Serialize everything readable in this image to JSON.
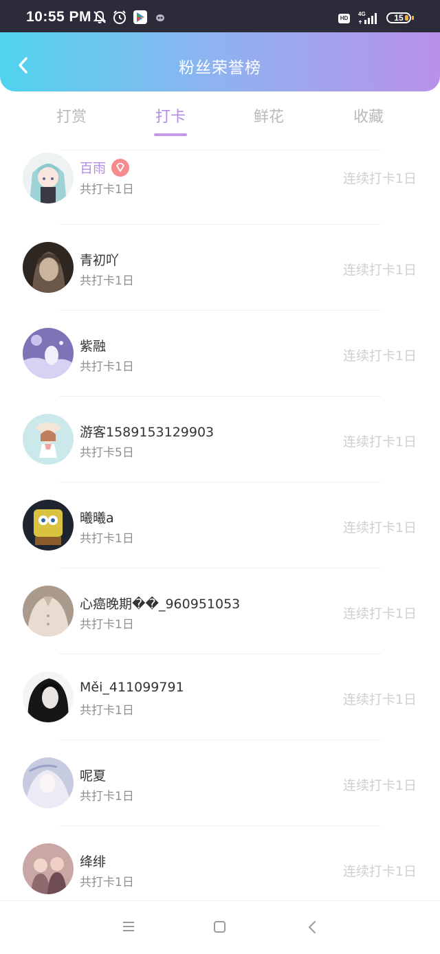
{
  "status_bar": {
    "time": "10:55 PM",
    "network": "4G",
    "hd_label": "HD",
    "battery": "15",
    "icons": [
      "bell-off-icon",
      "alarm-icon",
      "play-store-icon",
      "notification-dot-icon",
      "hd-icon",
      "signal-icon",
      "battery-icon"
    ]
  },
  "header": {
    "title": "粉丝荣誉榜",
    "back_icon": "chevron-left-icon",
    "gradient": [
      "#4fd3ee",
      "#b991ea"
    ]
  },
  "tabs": [
    {
      "label": "打赏",
      "active": false
    },
    {
      "label": "打卡",
      "active": true
    },
    {
      "label": "鲜花",
      "active": false
    },
    {
      "label": "收藏",
      "active": false
    }
  ],
  "accent_color": "#b38de4",
  "fans": [
    {
      "name": "百雨",
      "total": "共打卡1日",
      "streak": "连续打卡1日",
      "vip": true,
      "avatar": "anime-girl-twin-tails"
    },
    {
      "name": "青初吖",
      "total": "共打卡1日",
      "streak": "连续打卡1日",
      "vip": false,
      "avatar": "dark-portrait"
    },
    {
      "name": "紫融",
      "total": "共打卡1日",
      "streak": "连续打卡1日",
      "vip": false,
      "avatar": "purple-anime-scene"
    },
    {
      "name": "游客1589153129903",
      "total": "共打卡5日",
      "streak": "连续打卡1日",
      "vip": false,
      "avatar": "chibi-girl-hat"
    },
    {
      "name": "曦曦a",
      "total": "共打卡1日",
      "streak": "连续打卡1日",
      "vip": false,
      "avatar": "sponge-cartoon"
    },
    {
      "name": "心癌晚期��_960951053",
      "total": "共打卡1日",
      "streak": "连续打卡1日",
      "vip": false,
      "avatar": "beige-shirt-photo"
    },
    {
      "name": "Měi_411099791",
      "total": "共打卡1日",
      "streak": "连续打卡1日",
      "vip": false,
      "avatar": "black-hair-girl"
    },
    {
      "name": "呢夏",
      "total": "共打卡1日",
      "streak": "连续打卡1日",
      "vip": false,
      "avatar": "pale-anime-girl"
    },
    {
      "name": "绛绯",
      "total": "共打卡1日",
      "streak": "连续打卡1日",
      "vip": false,
      "avatar": "pink-couple-photo"
    }
  ],
  "navbar": {
    "icons": [
      "menu-icon",
      "home-square-icon",
      "back-triangle-icon"
    ]
  }
}
